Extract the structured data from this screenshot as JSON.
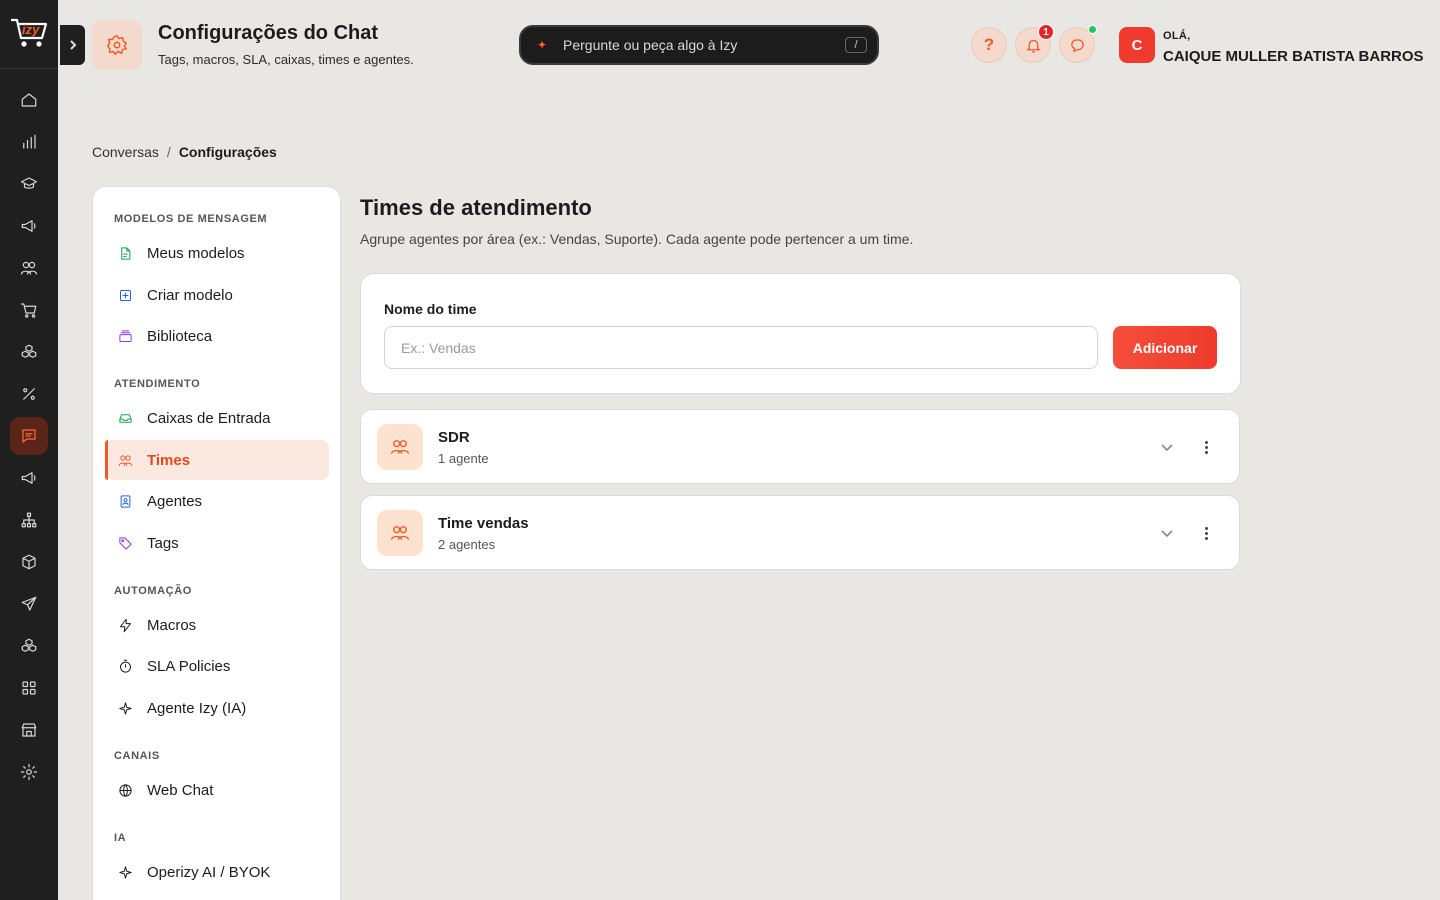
{
  "brand": {
    "logo_text": "izy"
  },
  "header": {
    "title": "Configurações do Chat",
    "subtitle": "Tags, macros, SLA, caixas, times e agentes.",
    "ask_placeholder": "Pergunte ou peça algo à Izy",
    "ask_shortcut": "/",
    "help_label": "?",
    "notification_count": "1",
    "greeting": "OLÁ,",
    "user_name": "CAIQUE MULLER BATISTA BARROS",
    "user_initial": "C"
  },
  "breadcrumb": {
    "parent": "Conversas",
    "separator": "/",
    "current": "Configurações"
  },
  "settings_nav": {
    "sections": {
      "models": "MODELOS DE MENSAGEM",
      "service": "ATENDIMENTO",
      "automation": "AUTOMAÇÃO",
      "channels": "CANAIS",
      "ai": "IA"
    },
    "items": {
      "my_models": "Meus modelos",
      "create_model": "Criar modelo",
      "library": "Biblioteca",
      "inboxes": "Caixas de Entrada",
      "teams": "Times",
      "agents": "Agentes",
      "tags": "Tags",
      "macros": "Macros",
      "sla": "SLA Policies",
      "izy_agent": "Agente Izy (IA)",
      "web_chat": "Web Chat",
      "byok": "Operizy AI / BYOK"
    }
  },
  "main": {
    "title": "Times de atendimento",
    "subtitle": "Agrupe agentes por área (ex.: Vendas, Suporte). Cada agente pode pertencer a um time.",
    "form": {
      "label": "Nome do time",
      "placeholder": "Ex.: Vendas",
      "value": "",
      "add_button": "Adicionar"
    },
    "teams": [
      {
        "name": "SDR",
        "count": "1 agente"
      },
      {
        "name": "Time vendas",
        "count": "2 agentes"
      }
    ]
  },
  "colors": {
    "accent": "#f05a28",
    "rail_bg": "#1f1f1f",
    "page_bg": "#e9e7e3",
    "primary_button": "#ef3b2d"
  }
}
